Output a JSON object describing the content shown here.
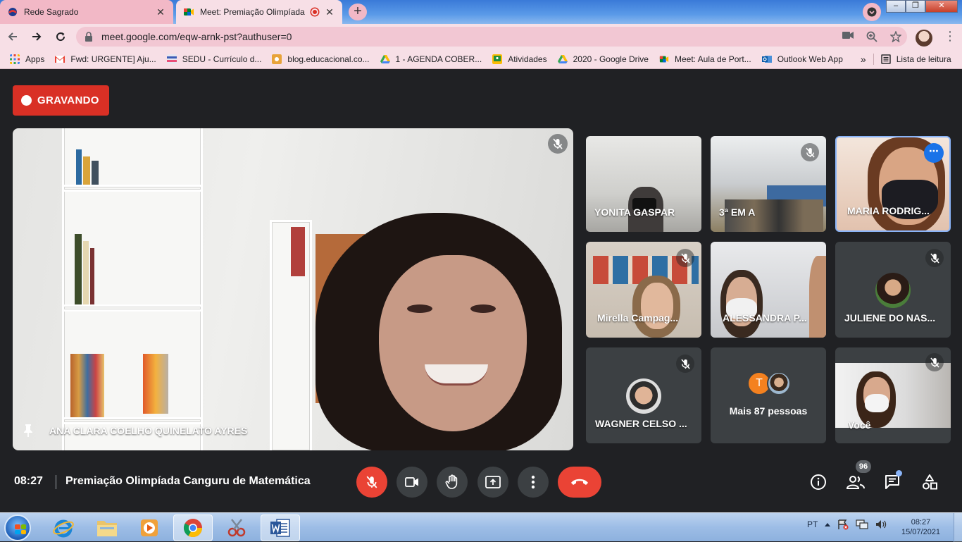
{
  "browser": {
    "tabs": [
      {
        "title": "Rede Sagrado",
        "active": false
      },
      {
        "title": "Meet: Premiação Olimpíada",
        "active": true
      }
    ],
    "url": "meet.google.com/eqw-arnk-pst?authuser=0",
    "bookmarks": [
      {
        "label": "Apps",
        "icon": "apps-grid-icon"
      },
      {
        "label": "Fwd: URGENTE] Aju...",
        "icon": "gmail-icon"
      },
      {
        "label": "SEDU - Currículo d...",
        "icon": "sedu-icon"
      },
      {
        "label": "blog.educacional.co...",
        "icon": "blog-icon"
      },
      {
        "label": "1 - AGENDA COBER...",
        "icon": "google-drive-icon"
      },
      {
        "label": "Atividades",
        "icon": "classroom-icon"
      },
      {
        "label": "2020 - Google Drive",
        "icon": "google-drive-icon"
      },
      {
        "label": "Meet: Aula de Port...",
        "icon": "meet-icon"
      },
      {
        "label": "Outlook Web App",
        "icon": "outlook-icon"
      }
    ],
    "bookmarks_more": "»",
    "reading_list": "Lista de leitura"
  },
  "meet": {
    "recording_label": "GRAVANDO",
    "main_speaker": "ANA CLARA COELHO QUINELATO AYRES",
    "participants": [
      {
        "name": "YONITA GASPAR"
      },
      {
        "name": "3ª EM A"
      },
      {
        "name": "MARIA RODRIG..."
      },
      {
        "name": "Mirella Campag..."
      },
      {
        "name": "ALESSANDRA P..."
      },
      {
        "name": "JULIENE DO NAS..."
      },
      {
        "name": "WAGNER CELSO ..."
      },
      {
        "name": "Você"
      }
    ],
    "more_people": {
      "label": "Mais 87 pessoas",
      "initial": "T"
    },
    "time": "08:27",
    "meeting_title": "Premiação Olimpíada Canguru de Matemática",
    "participants_count": "96"
  },
  "taskbar": {
    "language": "PT",
    "time": "08:27",
    "date": "15/07/2021"
  },
  "colors": {
    "meet_background": "#202124",
    "danger_red": "#ea4335",
    "tile_gray": "#3c4043",
    "accent_blue": "#1a73e8"
  }
}
